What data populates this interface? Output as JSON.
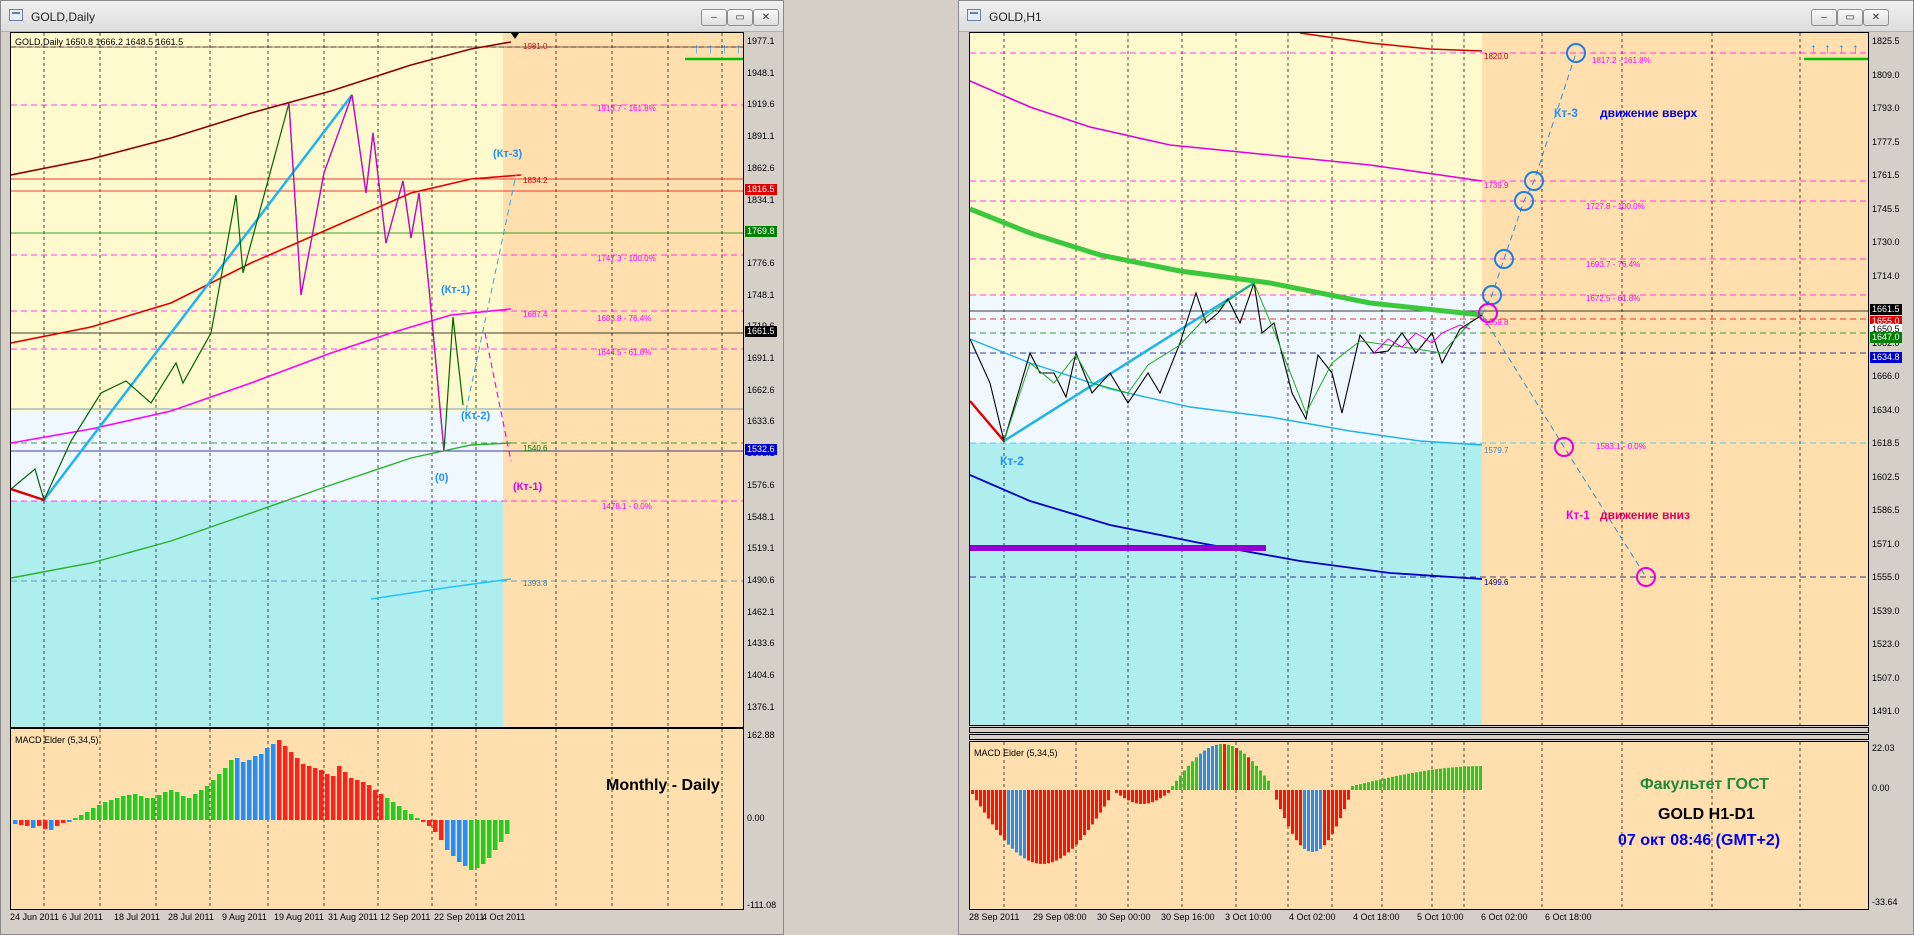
{
  "left_window": {
    "title": "GOLD,Daily",
    "header": "GOLD,Daily  1650.8 1666.2 1648.5 1661.5",
    "indicator_label": "MACD Elder (5,34,5)",
    "caption": "Monthly - Daily",
    "price_ticks": [
      "1977.1",
      "1948.1",
      "1919.6",
      "1891.1",
      "1862.6",
      "1834.1",
      "1805.1",
      "1776.6",
      "1748.1",
      "1719.6",
      "1691.1",
      "1662.6",
      "1633.6",
      "1605.1",
      "1576.6",
      "1548.1",
      "1519.1",
      "1490.6",
      "1462.1",
      "1433.6",
      "1404.6",
      "1376.1"
    ],
    "macd_ticks": [
      "162.88",
      "0.00",
      "-111.08"
    ],
    "time_ticks": [
      "24 Jun 2011",
      "6 Jul 2011",
      "18 Jul 2011",
      "28 Jul 2011",
      "9 Aug 2011",
      "19 Aug 2011",
      "31 Aug 2011",
      "12 Sep 2011",
      "22 Sep 2011",
      "4 Oct 2011"
    ],
    "level_labels": [
      "1981.0",
      "1913.7 - 161.8%",
      "1834.2",
      "1747.3 - 100.0%",
      "1687.4",
      "1683.8 - 76.4%",
      "1644.5 - 61.8%",
      "1540.6",
      "1478.1 - 0.0%",
      "1393.8"
    ],
    "price_tags": [
      "1816.5",
      "1769.8",
      "1661.5",
      "1532.6"
    ],
    "wave_labels": [
      "(Кт-3)",
      "(Кт-1)",
      "(Кт-2)",
      "(0)",
      "(Кт-1)"
    ]
  },
  "right_window": {
    "title": "GOLD,H1",
    "indicator_label": "MACD Elder (5,34,5)",
    "caption_1": "Факультет ГОСТ",
    "caption_2": "GOLD  H1-D1",
    "caption_3": "07  окт 08:46 (GMT+2)",
    "price_ticks": [
      "1825.5",
      "1809.0",
      "1793.0",
      "1777.5",
      "1761.5",
      "1745.5",
      "1730.0",
      "1714.0",
      "1698.0",
      "1682.0",
      "1666.0",
      "1634.0",
      "1618.5",
      "1602.5",
      "1586.5",
      "1571.0",
      "1555.0",
      "1539.0",
      "1523.0",
      "1507.0",
      "1491.0"
    ],
    "macd_ticks": [
      "22.03",
      "0.00",
      "-33.64"
    ],
    "time_ticks": [
      "28 Sep 2011",
      "29 Sep 08:00",
      "30 Sep 00:00",
      "30 Sep 16:00",
      "3 Oct 10:00",
      "4 Oct 02:00",
      "4 Oct 18:00",
      "5 Oct 10:00",
      "6 Oct 02:00",
      "6 Oct 18:00"
    ],
    "level_labels": [
      "1820.0",
      "1817.2 - 161.8%",
      "1739.9",
      "1727.8 - 100.0%",
      "1693.7 - 76.4%",
      "1672.5 - 61.8%",
      "1659.8",
      "1583.1 - 0.0%",
      "1579.7",
      "1499.6"
    ],
    "price_tags": [
      "1661.5",
      "1655.0",
      "1650.5",
      "1647.0",
      "1634.8"
    ],
    "wave_labels": [
      "Кт-3",
      "движение вверх",
      "Кт-2",
      "Кт-1",
      "движение вниз"
    ]
  },
  "colors": {
    "chart_bg": "#ffdfae",
    "zone_yellow": "#fffacd",
    "zone_lightblue": "#f0f8ff",
    "zone_teal": "#afeeee",
    "magenta": "#ff00ff",
    "green": "#00c800",
    "red": "#ff0000",
    "blue": "#0000ff",
    "deepskyblue": "#1e90ff"
  },
  "chart_data": [
    {
      "type": "line",
      "title": "GOLD,Daily",
      "ylim": [
        1376.1,
        1977.1
      ],
      "levels": [
        1981.0,
        1913.7,
        1834.2,
        1816.5,
        1769.8,
        1747.3,
        1687.4,
        1683.8,
        1661.5,
        1644.5,
        1540.6,
        1532.6,
        1478.1,
        1393.8
      ],
      "ohlc_last": {
        "open": 1650.8,
        "high": 1666.2,
        "low": 1648.5,
        "close": 1661.5
      }
    },
    {
      "type": "line",
      "title": "GOLD,H1",
      "ylim": [
        1491.0,
        1825.5
      ],
      "levels": [
        1820.0,
        1817.2,
        1739.9,
        1727.8,
        1693.7,
        1672.5,
        1661.5,
        1659.8,
        1655.0,
        1650.5,
        1647.0,
        1634.8,
        1583.1,
        1579.7,
        1499.6
      ]
    }
  ]
}
